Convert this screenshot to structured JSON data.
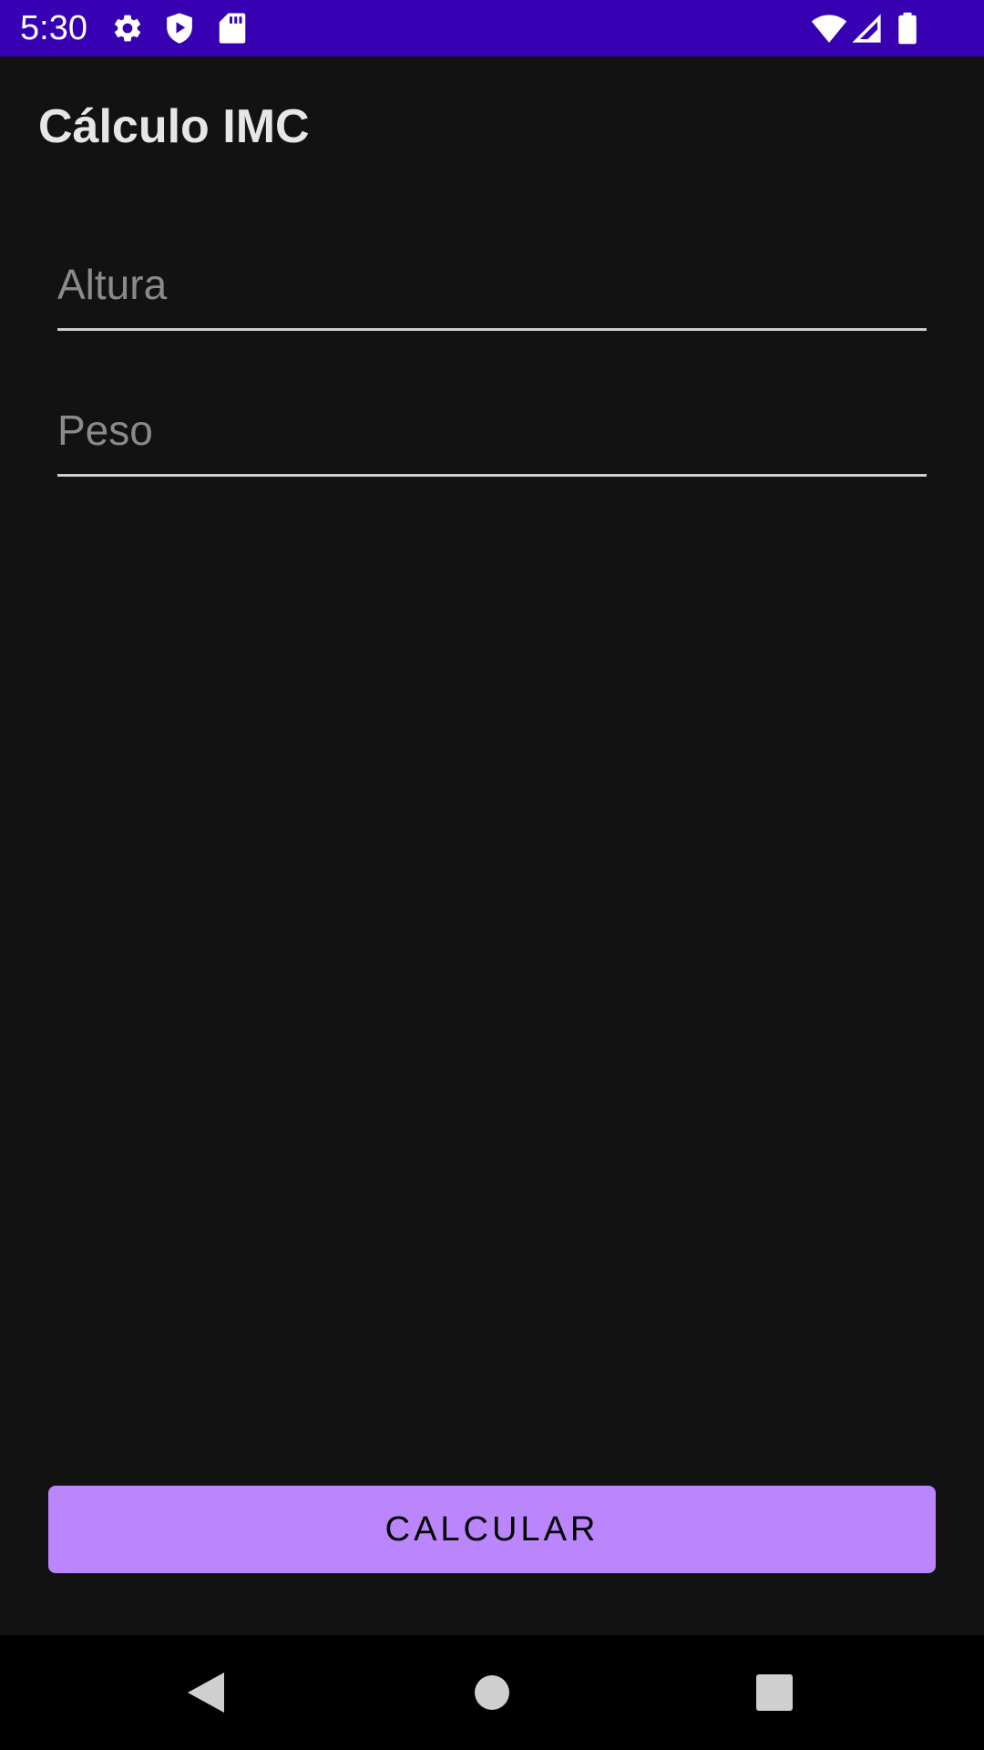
{
  "status_bar": {
    "time": "5:30",
    "left_icons": [
      "gear-icon",
      "shield-play-icon",
      "sd-card-icon"
    ],
    "right_icons": [
      "wifi-icon",
      "cell-signal-icon",
      "battery-icon"
    ],
    "background": "#3700b3"
  },
  "app": {
    "title": "Cálculo IMC",
    "background": "#121212"
  },
  "form": {
    "altura": {
      "value": "",
      "placeholder": "Altura"
    },
    "peso": {
      "value": "",
      "placeholder": "Peso"
    }
  },
  "actions": {
    "calculate_label": "CALCULAR",
    "accent": "#bb86fc"
  },
  "nav_bar": {
    "buttons": [
      "back-icon",
      "home-icon",
      "recents-icon"
    ]
  }
}
